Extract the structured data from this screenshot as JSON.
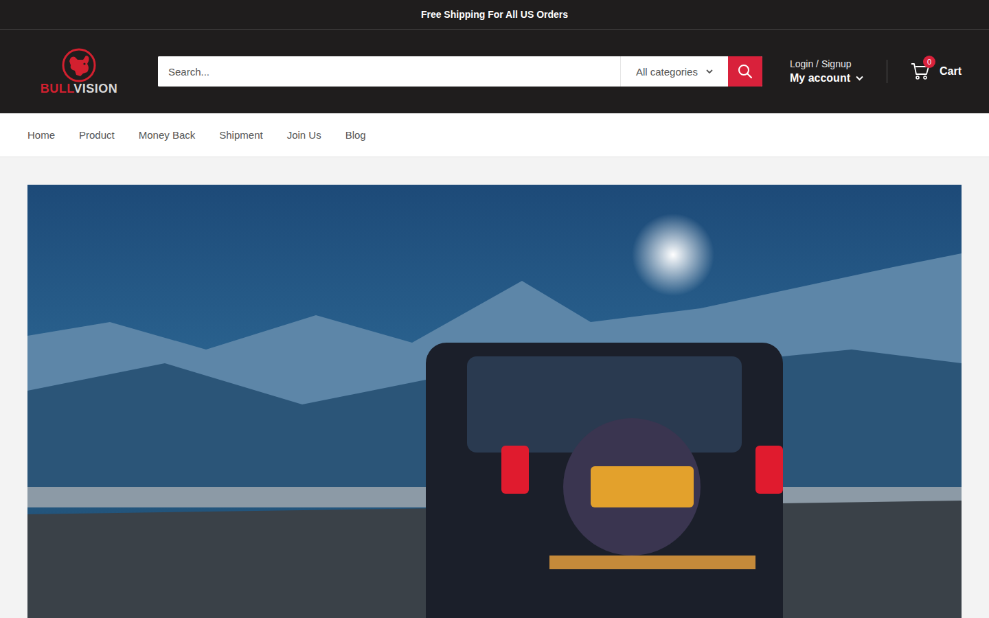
{
  "announcement": "Free Shipping For All US Orders",
  "logo": {
    "part1": "BULL",
    "part2": "VISION"
  },
  "search": {
    "placeholder": "Search...",
    "category": "All categories"
  },
  "account": {
    "login": "Login / Signup",
    "label": "My account"
  },
  "cart": {
    "count": "0",
    "label": "Cart"
  },
  "nav": {
    "items": [
      {
        "label": "Home"
      },
      {
        "label": "Product"
      },
      {
        "label": "Money Back"
      },
      {
        "label": "Shipment"
      },
      {
        "label": "Join Us"
      },
      {
        "label": "Blog"
      }
    ]
  }
}
